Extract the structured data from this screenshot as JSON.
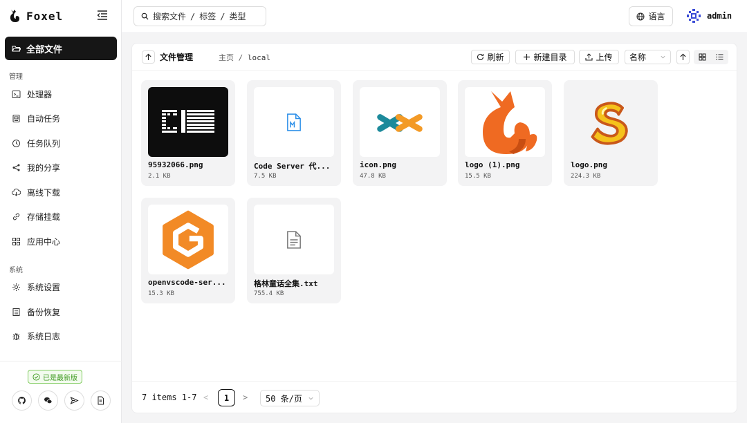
{
  "app": {
    "name": "Foxel"
  },
  "sidebar": {
    "active": {
      "label": "全部文件",
      "icon": "folder-open-icon"
    },
    "groups": [
      {
        "title": "管理",
        "items": [
          {
            "label": "处理器",
            "icon": "terminal-icon"
          },
          {
            "label": "自动任务",
            "icon": "robot-icon"
          },
          {
            "label": "任务队列",
            "icon": "clock-icon"
          },
          {
            "label": "我的分享",
            "icon": "share-icon"
          },
          {
            "label": "离线下载",
            "icon": "cloud-download-icon"
          },
          {
            "label": "存储挂载",
            "icon": "link-icon"
          },
          {
            "label": "应用中心",
            "icon": "apps-grid-icon"
          }
        ]
      },
      {
        "title": "系统",
        "items": [
          {
            "label": "系统设置",
            "icon": "gear-icon"
          },
          {
            "label": "备份恢复",
            "icon": "archive-icon"
          },
          {
            "label": "系统日志",
            "icon": "bug-icon"
          }
        ]
      }
    ],
    "version_badge": "已是最新版",
    "footer_icons": [
      "github-icon",
      "wechat-icon",
      "send-icon",
      "document-icon"
    ]
  },
  "topbar": {
    "search_segments": [
      "搜索文件",
      "/",
      "标签",
      "/",
      "类型"
    ],
    "language_label": "语言",
    "username": "admin"
  },
  "file_manager": {
    "title": "文件管理",
    "breadcrumb": [
      "主页",
      "/",
      "local"
    ],
    "toolbar": {
      "refresh": "刷新",
      "new_folder": "新建目录",
      "upload": "上传",
      "sort_by": "名称"
    },
    "files": [
      {
        "name": "95932066.png",
        "size": "2.1 KB",
        "thumb": "ci-logo"
      },
      {
        "name": "Code Server 代...",
        "size": "7.5 KB",
        "thumb": "markdown-file-icon"
      },
      {
        "name": "icon.png",
        "size": "47.8 KB",
        "thumb": "cross-logo"
      },
      {
        "name": "logo (1).png",
        "size": "15.5 KB",
        "thumb": "fox-logo"
      },
      {
        "name": "logo.png",
        "size": "224.3 KB",
        "thumb": "s-logo"
      },
      {
        "name": "openvscode-ser...",
        "size": "15.3 KB",
        "thumb": "g-hex-logo"
      },
      {
        "name": "格林童话全集.txt",
        "size": "755.4 KB",
        "thumb": "text-file-icon"
      }
    ],
    "pagination": {
      "range": "7 items 1-7",
      "prev": "<",
      "current": "1",
      "next": ">",
      "page_size": "50 条/页"
    }
  },
  "colors": {
    "accent_dark": "#161616",
    "success": "#3d9a1f",
    "fox_orange": "#ef6a22",
    "markdown_blue": "#2b8ee8"
  }
}
